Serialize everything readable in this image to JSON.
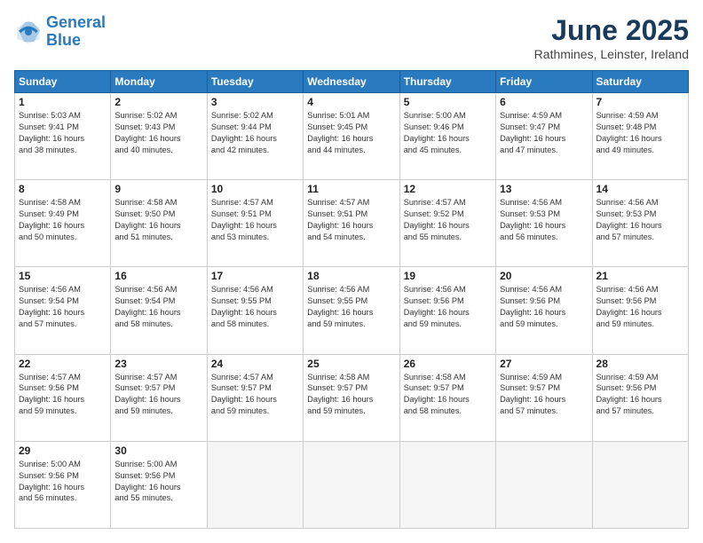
{
  "logo": {
    "line1": "General",
    "line2": "Blue"
  },
  "title": "June 2025",
  "location": "Rathmines, Leinster, Ireland",
  "days_header": [
    "Sunday",
    "Monday",
    "Tuesday",
    "Wednesday",
    "Thursday",
    "Friday",
    "Saturday"
  ],
  "weeks": [
    [
      {
        "day": "1",
        "detail": "Sunrise: 5:03 AM\nSunset: 9:41 PM\nDaylight: 16 hours\nand 38 minutes."
      },
      {
        "day": "2",
        "detail": "Sunrise: 5:02 AM\nSunset: 9:43 PM\nDaylight: 16 hours\nand 40 minutes."
      },
      {
        "day": "3",
        "detail": "Sunrise: 5:02 AM\nSunset: 9:44 PM\nDaylight: 16 hours\nand 42 minutes."
      },
      {
        "day": "4",
        "detail": "Sunrise: 5:01 AM\nSunset: 9:45 PM\nDaylight: 16 hours\nand 44 minutes."
      },
      {
        "day": "5",
        "detail": "Sunrise: 5:00 AM\nSunset: 9:46 PM\nDaylight: 16 hours\nand 45 minutes."
      },
      {
        "day": "6",
        "detail": "Sunrise: 4:59 AM\nSunset: 9:47 PM\nDaylight: 16 hours\nand 47 minutes."
      },
      {
        "day": "7",
        "detail": "Sunrise: 4:59 AM\nSunset: 9:48 PM\nDaylight: 16 hours\nand 49 minutes."
      }
    ],
    [
      {
        "day": "8",
        "detail": "Sunrise: 4:58 AM\nSunset: 9:49 PM\nDaylight: 16 hours\nand 50 minutes."
      },
      {
        "day": "9",
        "detail": "Sunrise: 4:58 AM\nSunset: 9:50 PM\nDaylight: 16 hours\nand 51 minutes."
      },
      {
        "day": "10",
        "detail": "Sunrise: 4:57 AM\nSunset: 9:51 PM\nDaylight: 16 hours\nand 53 minutes."
      },
      {
        "day": "11",
        "detail": "Sunrise: 4:57 AM\nSunset: 9:51 PM\nDaylight: 16 hours\nand 54 minutes."
      },
      {
        "day": "12",
        "detail": "Sunrise: 4:57 AM\nSunset: 9:52 PM\nDaylight: 16 hours\nand 55 minutes."
      },
      {
        "day": "13",
        "detail": "Sunrise: 4:56 AM\nSunset: 9:53 PM\nDaylight: 16 hours\nand 56 minutes."
      },
      {
        "day": "14",
        "detail": "Sunrise: 4:56 AM\nSunset: 9:53 PM\nDaylight: 16 hours\nand 57 minutes."
      }
    ],
    [
      {
        "day": "15",
        "detail": "Sunrise: 4:56 AM\nSunset: 9:54 PM\nDaylight: 16 hours\nand 57 minutes."
      },
      {
        "day": "16",
        "detail": "Sunrise: 4:56 AM\nSunset: 9:54 PM\nDaylight: 16 hours\nand 58 minutes."
      },
      {
        "day": "17",
        "detail": "Sunrise: 4:56 AM\nSunset: 9:55 PM\nDaylight: 16 hours\nand 58 minutes."
      },
      {
        "day": "18",
        "detail": "Sunrise: 4:56 AM\nSunset: 9:55 PM\nDaylight: 16 hours\nand 59 minutes."
      },
      {
        "day": "19",
        "detail": "Sunrise: 4:56 AM\nSunset: 9:56 PM\nDaylight: 16 hours\nand 59 minutes."
      },
      {
        "day": "20",
        "detail": "Sunrise: 4:56 AM\nSunset: 9:56 PM\nDaylight: 16 hours\nand 59 minutes."
      },
      {
        "day": "21",
        "detail": "Sunrise: 4:56 AM\nSunset: 9:56 PM\nDaylight: 16 hours\nand 59 minutes."
      }
    ],
    [
      {
        "day": "22",
        "detail": "Sunrise: 4:57 AM\nSunset: 9:56 PM\nDaylight: 16 hours\nand 59 minutes."
      },
      {
        "day": "23",
        "detail": "Sunrise: 4:57 AM\nSunset: 9:57 PM\nDaylight: 16 hours\nand 59 minutes."
      },
      {
        "day": "24",
        "detail": "Sunrise: 4:57 AM\nSunset: 9:57 PM\nDaylight: 16 hours\nand 59 minutes."
      },
      {
        "day": "25",
        "detail": "Sunrise: 4:58 AM\nSunset: 9:57 PM\nDaylight: 16 hours\nand 59 minutes."
      },
      {
        "day": "26",
        "detail": "Sunrise: 4:58 AM\nSunset: 9:57 PM\nDaylight: 16 hours\nand 58 minutes."
      },
      {
        "day": "27",
        "detail": "Sunrise: 4:59 AM\nSunset: 9:57 PM\nDaylight: 16 hours\nand 57 minutes."
      },
      {
        "day": "28",
        "detail": "Sunrise: 4:59 AM\nSunset: 9:56 PM\nDaylight: 16 hours\nand 57 minutes."
      }
    ],
    [
      {
        "day": "29",
        "detail": "Sunrise: 5:00 AM\nSunset: 9:56 PM\nDaylight: 16 hours\nand 56 minutes."
      },
      {
        "day": "30",
        "detail": "Sunrise: 5:00 AM\nSunset: 9:56 PM\nDaylight: 16 hours\nand 55 minutes."
      },
      {
        "day": "",
        "detail": ""
      },
      {
        "day": "",
        "detail": ""
      },
      {
        "day": "",
        "detail": ""
      },
      {
        "day": "",
        "detail": ""
      },
      {
        "day": "",
        "detail": ""
      }
    ]
  ]
}
